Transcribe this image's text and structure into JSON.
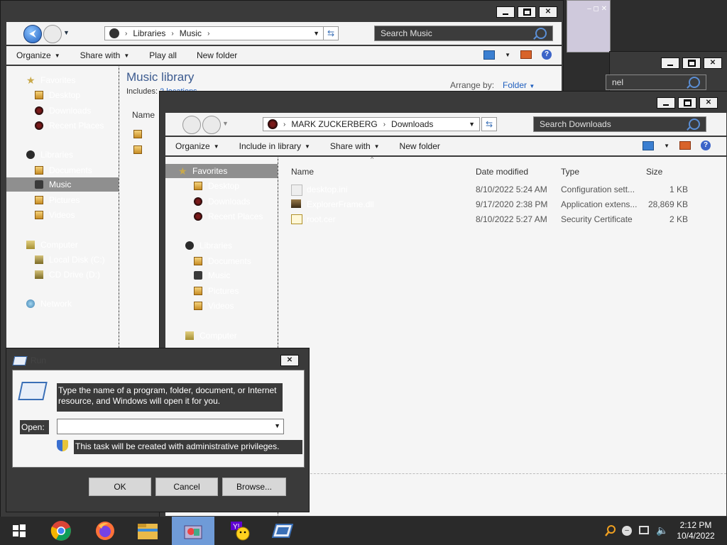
{
  "music_window": {
    "breadcrumb": [
      "Libraries",
      "Music"
    ],
    "search_placeholder": "Search Music",
    "toolbar": {
      "organize": "Organize",
      "share_with": "Share with",
      "play_all": "Play all",
      "new_folder": "New folder"
    },
    "library_title": "Music library",
    "includes_label": "Includes:",
    "includes_link": "2 locations",
    "arrange_by_label": "Arrange by:",
    "arrange_by_value": "Folder",
    "col_name": "Name",
    "nav": {
      "favorites": "Favorites",
      "desktop": "Desktop",
      "downloads": "Downloads",
      "recent": "Recent Places",
      "libraries": "Libraries",
      "documents": "Documents",
      "music": "Music",
      "pictures": "Pictures",
      "videos": "Videos",
      "computer": "Computer",
      "local_disk": "Local Disk (C:)",
      "cd_drive": "CD Drive (D:)",
      "network": "Network"
    }
  },
  "third_window": {
    "search_fragment": "nel"
  },
  "downloads_window": {
    "breadcrumb": [
      "MARK ZUCKERBERG",
      "Downloads"
    ],
    "search_placeholder": "Search Downloads",
    "toolbar": {
      "organize": "Organize",
      "include_in_library": "Include in library",
      "share_with": "Share with",
      "new_folder": "New folder"
    },
    "columns": {
      "name": "Name",
      "date": "Date modified",
      "type": "Type",
      "size": "Size"
    },
    "nav": {
      "favorites": "Favorites",
      "desktop": "Desktop",
      "downloads": "Downloads",
      "recent": "Recent Places",
      "libraries": "Libraries",
      "documents": "Documents",
      "music": "Music",
      "pictures": "Pictures",
      "videos": "Videos",
      "computer": "Computer"
    },
    "files": [
      {
        "name": "desktop.ini",
        "date": "8/10/2022 5:24 AM",
        "type": "Configuration sett...",
        "size": "1 KB"
      },
      {
        "name": "ExplorerFrame.dll",
        "date": "9/17/2020 2:38 PM",
        "type": "Application extens...",
        "size": "28,869 KB"
      },
      {
        "name": "root.cer",
        "date": "8/10/2022 5:27 AM",
        "type": "Security Certificate",
        "size": "2 KB"
      }
    ]
  },
  "run_dialog": {
    "title": "Run",
    "description": "Type the name of a program, folder, document, or Internet resource, and Windows will open it for you.",
    "open_label": "Open:",
    "open_value": "",
    "admin_note": "This task will be created with administrative privileges.",
    "ok": "OK",
    "cancel": "Cancel",
    "browse": "Browse..."
  },
  "taskbar": {
    "apps": [
      "start-icon",
      "chrome-icon",
      "firefox-icon",
      "file-explorer-icon",
      "control-panel-icon",
      "yahoo-messenger-icon",
      "run-icon"
    ],
    "time": "2:12 PM",
    "date": "10/4/2022"
  }
}
